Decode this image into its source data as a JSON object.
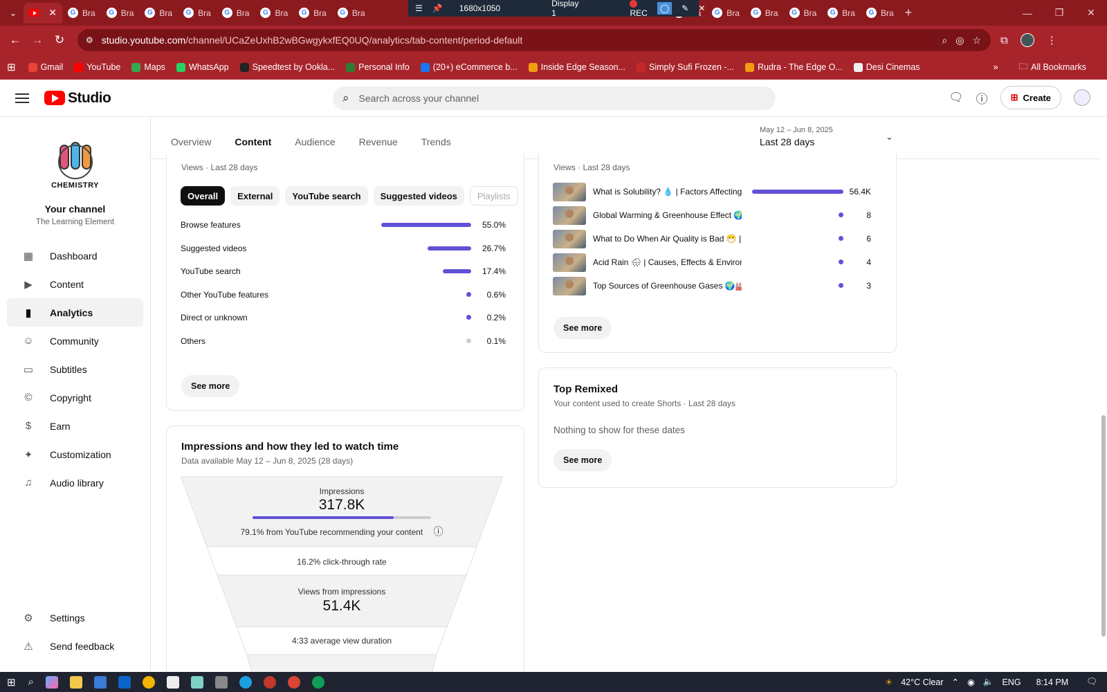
{
  "browser": {
    "tab_label": "Bra",
    "overlay": {
      "resolution": "1680x1050",
      "display": "Display 1",
      "rec": "REC"
    },
    "url_host": "studio.youtube.com",
    "url_path": "/channel/UCaZeUxhB2wBGwgykxfEQ0UQ/analytics/tab-content/period-default",
    "bookmarks": [
      "Gmail",
      "YouTube",
      "Maps",
      "WhatsApp",
      "Speedtest by Ookla...",
      "Personal Info",
      "(20+) eCommerce b...",
      "Inside Edge Season...",
      "Simply Sufi Frozen -...",
      "Rudra - The Edge O...",
      "Desi Cinemas"
    ],
    "all_bookmarks": "All Bookmarks"
  },
  "header": {
    "logo_text": "Studio",
    "search_placeholder": "Search across your channel",
    "create_label": "Create"
  },
  "sidebar": {
    "channel_logo_text": "CHEMISTRY",
    "channel_title": "Your channel",
    "channel_name": "The Learning Element",
    "items": [
      {
        "label": "Dashboard",
        "icon": "dashboard-icon"
      },
      {
        "label": "Content",
        "icon": "content-icon"
      },
      {
        "label": "Analytics",
        "icon": "analytics-icon"
      },
      {
        "label": "Community",
        "icon": "community-icon"
      },
      {
        "label": "Subtitles",
        "icon": "subtitles-icon"
      },
      {
        "label": "Copyright",
        "icon": "copyright-icon"
      },
      {
        "label": "Earn",
        "icon": "dollar-icon"
      },
      {
        "label": "Customization",
        "icon": "wand-icon"
      },
      {
        "label": "Audio library",
        "icon": "audio-library-icon"
      }
    ],
    "settings": "Settings",
    "feedback": "Send feedback"
  },
  "tabs": [
    "Overview",
    "Content",
    "Audience",
    "Revenue",
    "Trends"
  ],
  "period": {
    "range": "May 12 – Jun 8, 2025",
    "label": "Last 28 days"
  },
  "traffic": {
    "subtitle": "Views · Last 28 days",
    "filters": [
      "Overall",
      "External",
      "YouTube search",
      "Suggested videos",
      "Playlists"
    ],
    "rows": [
      {
        "label": "Browse features",
        "value": "55.0%",
        "pct": 55.0
      },
      {
        "label": "Suggested videos",
        "value": "26.7%",
        "pct": 26.7
      },
      {
        "label": "YouTube search",
        "value": "17.4%",
        "pct": 17.4
      },
      {
        "label": "Other YouTube features",
        "value": "0.6%",
        "pct": 0.6
      },
      {
        "label": "Direct or unknown",
        "value": "0.2%",
        "pct": 0.2
      },
      {
        "label": "Others",
        "value": "0.1%",
        "pct": 0.1
      }
    ],
    "see_more": "See more"
  },
  "top_content": {
    "subtitle": "Views · Last 28 days",
    "rows": [
      {
        "title": "What is Solubility? 💧 | Factors Affecting ...",
        "value": "56.4K",
        "views": 56400
      },
      {
        "title": "Global Warming & Greenhouse Effect 🌍...",
        "value": "8",
        "views": 8
      },
      {
        "title": "What to Do When Air Quality is Bad 😷 | ...",
        "value": "6",
        "views": 6
      },
      {
        "title": "Acid Rain 🌧 | Causes, Effects & Environ...",
        "value": "4",
        "views": 4
      },
      {
        "title": "Top Sources of Greenhouse Gases 🌍🏭...",
        "value": "3",
        "views": 3
      }
    ],
    "see_more": "See more"
  },
  "remixed": {
    "title": "Top Remixed",
    "subtitle": "Your content used to create Shorts · Last 28 days",
    "empty": "Nothing to show for these dates",
    "see_more": "See more"
  },
  "impressions": {
    "title": "Impressions and how they led to watch time",
    "subtitle": "Data available May 12 – Jun 8, 2025 (28 days)",
    "impressions_label": "Impressions",
    "impressions_value": "317.8K",
    "recommend_text": "79.1% from YouTube recommending your content",
    "recommend_pct": 79.1,
    "ctr_text": "16.2% click-through rate",
    "views_label": "Views from impressions",
    "views_value": "51.4K",
    "avg_duration_text": "4:33 average view duration"
  },
  "taskbar": {
    "weather": "42°C Clear",
    "lang": "ENG",
    "time": "8:14 PM"
  },
  "colors": {
    "accent": "#6051d6",
    "browser": "#a8242b",
    "brand_red": "#ff0000"
  }
}
